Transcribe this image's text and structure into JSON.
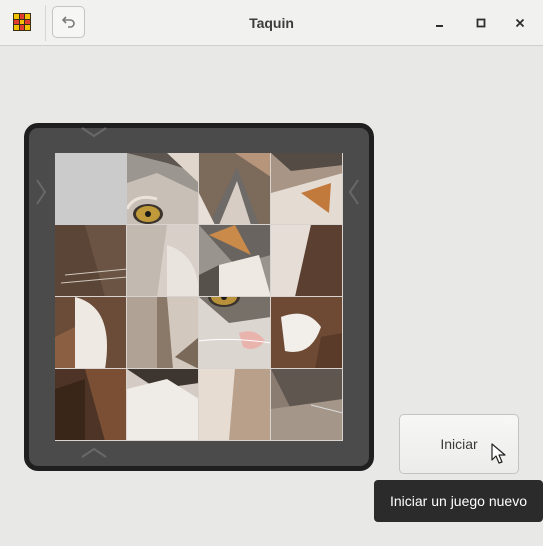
{
  "window": {
    "title": "Taquin",
    "controls": [
      "minimize",
      "maximize",
      "close"
    ]
  },
  "header": {
    "app_icon": "taquin-grid-icon",
    "undo_icon": "undo-icon"
  },
  "board": {
    "rows": 4,
    "columns": 4,
    "empty_tile": {
      "row": 1,
      "column": 1
    },
    "navigation_arrows": [
      "up",
      "down",
      "left",
      "right"
    ],
    "image_subject": "cat photo (scrambled tiles)"
  },
  "actions": {
    "start_label": "Iniciar",
    "start_tooltip": "Iniciar un juego nuevo"
  },
  "colors": {
    "board_background": "#4b4b4b",
    "board_border": "#1f1f1f",
    "empty_tile": "#cbcbcb",
    "tooltip_background": "#2b2b2b"
  }
}
